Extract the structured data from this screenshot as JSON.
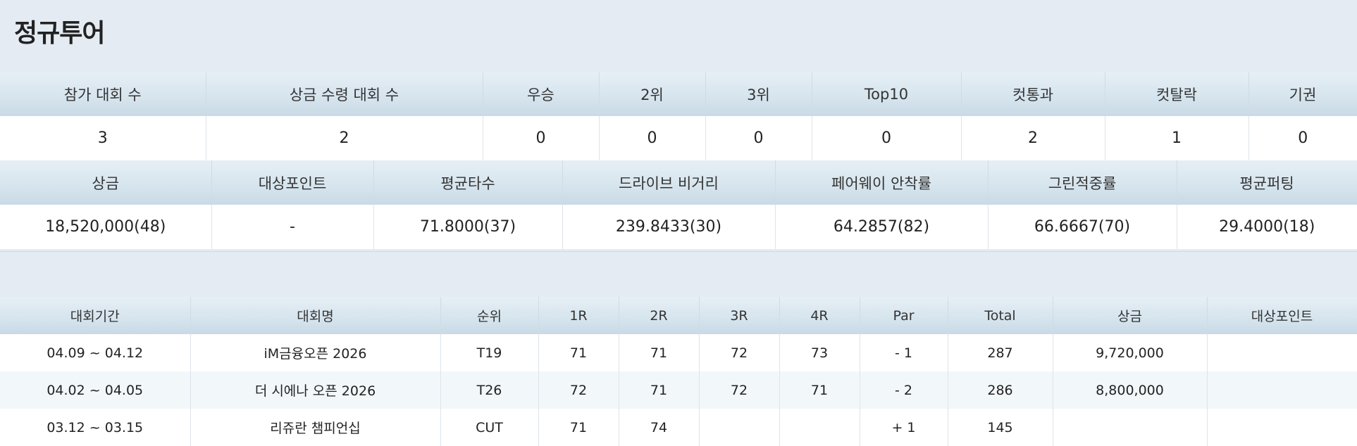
{
  "page_title": "정규투어",
  "stats1": {
    "headers": [
      "참가 대회 수",
      "상금 수령 대회 수",
      "우승",
      "2위",
      "3위",
      "Top10",
      "컷통과",
      "컷탈락",
      "기권"
    ],
    "values": [
      "3",
      "2",
      "0",
      "0",
      "0",
      "0",
      "2",
      "1",
      "0"
    ]
  },
  "stats2": {
    "headers": [
      "상금",
      "대상포인트",
      "평균타수",
      "드라이브 비거리",
      "페어웨이 안착률",
      "그린적중률",
      "평균퍼팅"
    ],
    "values": [
      "18,520,000(48)",
      "-",
      "71.8000(37)",
      "239.8433(30)",
      "64.2857(82)",
      "66.6667(70)",
      "29.4000(18)"
    ]
  },
  "results": {
    "headers": [
      "대회기간",
      "대회명",
      "순위",
      "1R",
      "2R",
      "3R",
      "4R",
      "Par",
      "Total",
      "상금",
      "대상포인트"
    ],
    "rows": [
      [
        "04.09 ~ 04.12",
        "iM금융오픈 2026",
        "T19",
        "71",
        "71",
        "72",
        "73",
        "- 1",
        "287",
        "9,720,000",
        ""
      ],
      [
        "04.02 ~ 04.05",
        "더 시에나 오픈 2026",
        "T26",
        "72",
        "71",
        "72",
        "71",
        "- 2",
        "286",
        "8,800,000",
        ""
      ],
      [
        "03.12 ~ 03.15",
        "리쥬란 챔피언십",
        "CUT",
        "71",
        "74",
        "",
        "",
        "+ 1",
        "145",
        "",
        ""
      ]
    ]
  }
}
